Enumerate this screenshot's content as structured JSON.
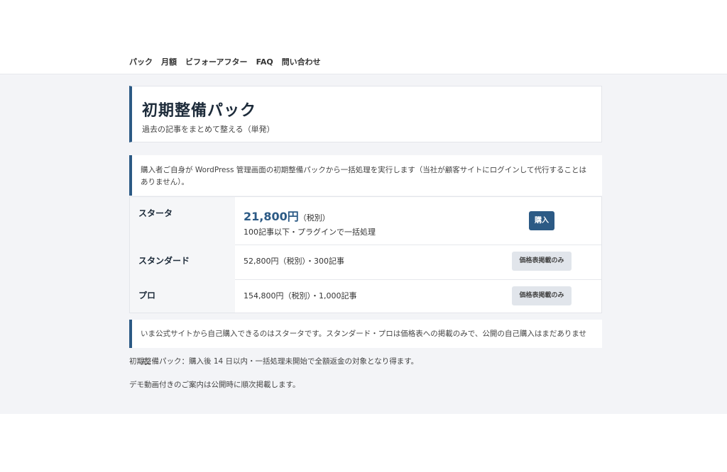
{
  "nav": {
    "items": [
      "パック",
      "月額",
      "ビフォーアフター",
      "FAQ",
      "問い合わせ"
    ]
  },
  "hero": {
    "title": "初期整備パック",
    "subtitle": "過去の記事をまとめて整える（単発）"
  },
  "notice_top": "購入者ご自身が WordPress 管理画面の初期整備パックから一括処理を実行します（当社が顧客サイトにログインして代行することはありません）。",
  "plans": [
    {
      "name": "スタータ",
      "price": "21,800円",
      "tax": "（税別）",
      "detail": "100記事以下・プラグインで一括処理",
      "button": "購入"
    },
    {
      "name": "スタンダード",
      "detail": "52,800円（税別）・300記事",
      "button": "価格表掲載のみ"
    },
    {
      "name": "プロ",
      "detail": "154,800円（税別）・1,000記事",
      "button": "価格表掲載のみ"
    }
  ],
  "notice_bottom": "いま公式サイトから自己購入できるのはスタータです。スタンダード・プロは価格表への掲載のみで、公開の自己購入はまだありません。",
  "footer": {
    "refund": "初期整備パック：購入後 14 日以内・一括処理未開始で全額返金の対象となり得ます。",
    "demo": "デモ動画付きのご案内は公開時に順次掲載します。"
  },
  "colors": {
    "accent": "#2c5a85",
    "page_bg": "#f3f4f7"
  }
}
